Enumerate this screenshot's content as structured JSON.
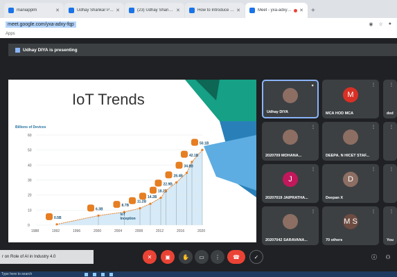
{
  "browser": {
    "tabs": [
      {
        "label": "maniapplm"
      },
      {
        "label": "Udhay Shankar Polavaram - Go"
      },
      {
        "label": "(23) Udhay Shankar Polavaram"
      },
      {
        "label": "How to Introduce resource pers"
      },
      {
        "label": "Meet - yxa-adxy-fqp",
        "active": true
      }
    ],
    "url": "meet.google.com/yxa-adxy-fqp",
    "bookmarks": "Apps"
  },
  "meet": {
    "presenting_text": "Udhay DIYA is presenting",
    "meeting_title": "r on Role of AI in Industry 4.0",
    "participants": [
      {
        "name": "Udhay DIYA",
        "type": "photo",
        "speaking": true
      },
      {
        "name": "MCA HOD MCA",
        "initial": "M",
        "color": "#d93025"
      },
      {
        "name": "ded",
        "initial": "",
        "color": "#3c4043"
      },
      {
        "name": "2020709 MOHANA...",
        "type": "photo"
      },
      {
        "name": "DEEPA. N HICET STAF...",
        "type": "photo"
      },
      {
        "name": "",
        "initial": "",
        "color": "#3c4043"
      },
      {
        "name": "20207019 JAIPRATHA...",
        "initial": "J",
        "color": "#c2185b"
      },
      {
        "name": "Deepan X",
        "initial": "D",
        "color": "#8d6e63"
      },
      {
        "name": "",
        "initial": "",
        "color": "#3c4043"
      },
      {
        "name": "20207042 SARAVANA...",
        "type": "photo"
      },
      {
        "name": "70 others",
        "initial": "M S",
        "color": "#6d4c41"
      },
      {
        "name": "You",
        "initial": "",
        "color": "#3c4043"
      }
    ]
  },
  "slide": {
    "title": "IoT Trends",
    "ylabel": "Billions of Devices",
    "inception": "IoT\nInception",
    "point_values": [
      "50.1B",
      "42.1B",
      "34.8B",
      "28.4B",
      "22.9B",
      "18.2B",
      "14.2B",
      "11.2B",
      "8.7B",
      "6.3B",
      "0.5B"
    ]
  },
  "chart_data": {
    "type": "line",
    "x": [
      1988,
      1992,
      1996,
      2000,
      2004,
      2008,
      2012,
      2016,
      2020
    ],
    "xlabel": "",
    "ylabel": "Billions of Devices",
    "ylim": [
      0,
      60
    ],
    "yticks": [
      0,
      10,
      20,
      30,
      40,
      50,
      60
    ],
    "points": [
      {
        "x": 1992,
        "y": 0.5,
        "label": "0.5B"
      },
      {
        "x": 2000,
        "y": 6.3,
        "label": "6.3B"
      },
      {
        "x": 2005,
        "y": 8.7,
        "label": "8.7B"
      },
      {
        "x": 2008,
        "y": 11.2,
        "label": "11.2B"
      },
      {
        "x": 2010,
        "y": 14.2,
        "label": "14.2B"
      },
      {
        "x": 2012,
        "y": 18.2,
        "label": "18.2B"
      },
      {
        "x": 2013,
        "y": 22.9,
        "label": "22.9B"
      },
      {
        "x": 2015,
        "y": 28.4,
        "label": "28.4B"
      },
      {
        "x": 2017,
        "y": 34.8,
        "label": "34.8B"
      },
      {
        "x": 2018,
        "y": 42.1,
        "label": "42.1B"
      },
      {
        "x": 2020,
        "y": 50.1,
        "label": "50.1B"
      }
    ]
  },
  "taskbar": {
    "search": "Type here to search"
  },
  "colors": {
    "accent": "#1a73e8",
    "end_call": "#ea4335",
    "slide_teal": "#16a085",
    "slide_blue": "#2980b9"
  }
}
